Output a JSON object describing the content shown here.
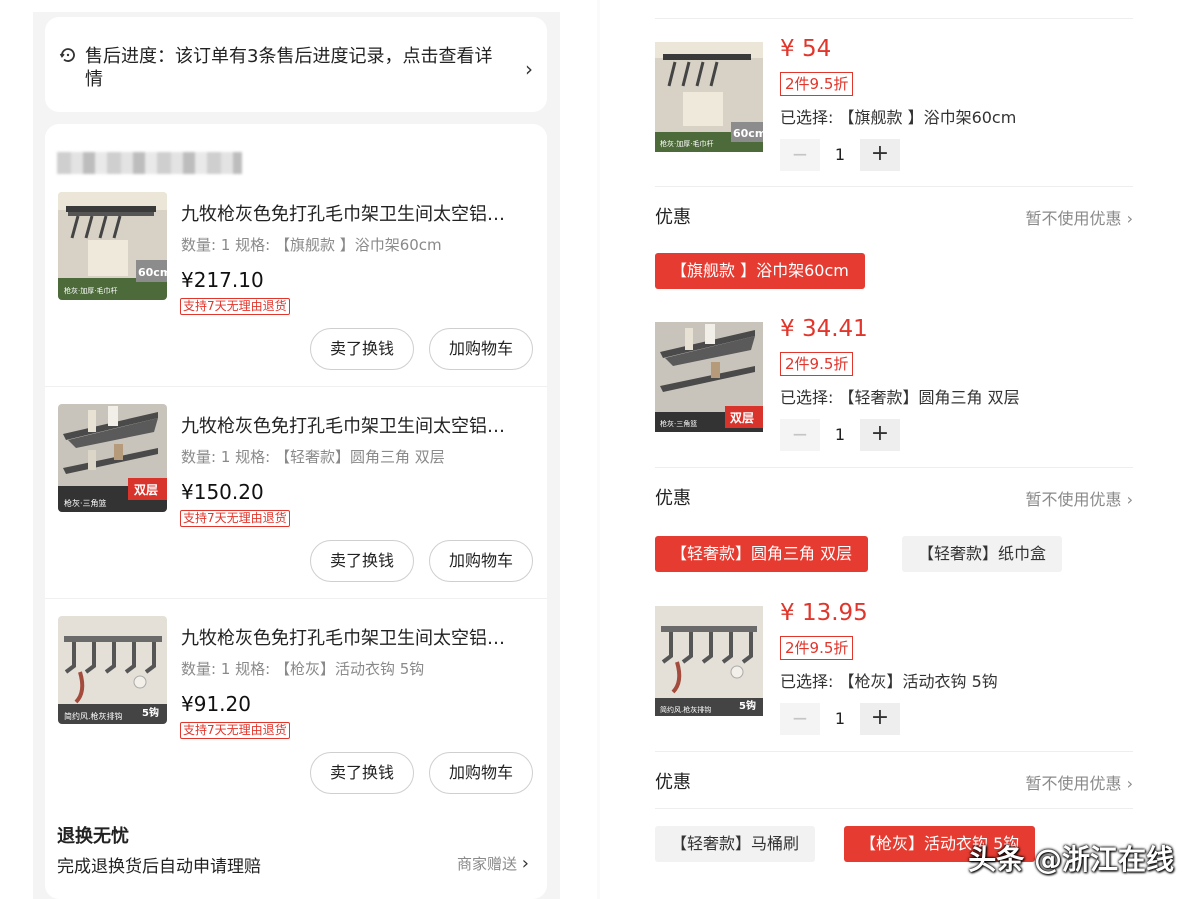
{
  "left": {
    "aftersale": {
      "text": "售后进度：该订单有3条售后进度记录，点击查看详情"
    },
    "items": [
      {
        "title": "九牧枪灰色免打孔毛巾架卫生间太空铝…",
        "spec": "数量: 1  规格: 【旗舰款 】浴巾架60cm",
        "price": "¥217.10",
        "tag": "支持7天无理由退货",
        "sell": "卖了换钱",
        "cart": "加购物车",
        "img_banner": "枪灰·加厚·毛巾杆",
        "img_badge": "60cm"
      },
      {
        "title": "九牧枪灰色免打孔毛巾架卫生间太空铝…",
        "spec": "数量: 1  规格: 【轻奢款】圆角三角 双层",
        "price": "¥150.20",
        "tag": "支持7天无理由退货",
        "sell": "卖了换钱",
        "cart": "加购物车",
        "img_banner": "枪灰·三角篮",
        "img_badge": "双层"
      },
      {
        "title": "九牧枪灰色免打孔毛巾架卫生间太空铝…",
        "spec": "数量: 1  规格: 【枪灰】活动衣钩 5钩",
        "price": "¥91.20",
        "tag": "支持7天无理由退货",
        "sell": "卖了换钱",
        "cart": "加购物车",
        "img_banner": "简约风.枪灰排钩",
        "img_badge": "5钩"
      }
    ],
    "guarantee": {
      "title": "退换无忧",
      "desc": "完成退换货后自动申请理赔",
      "link": "商家赠送"
    }
  },
  "right": {
    "items": [
      {
        "price": "¥ 54",
        "discount": "2件9.5折",
        "selected": "已选择: 【旗舰款 】浴巾架60cm",
        "qty": "1",
        "img_badge": "60cm",
        "img_banner": "枪灰·加厚·毛巾杆"
      },
      {
        "price": "¥ 34.41",
        "discount": "2件9.5折",
        "selected": "已选择: 【轻奢款】圆角三角 双层",
        "qty": "1",
        "img_badge": "双层",
        "img_banner": "枪灰·三角篮"
      },
      {
        "price": "¥ 13.95",
        "discount": "2件9.5折",
        "selected": "已选择: 【枪灰】活动衣钩 5钩",
        "qty": "1",
        "img_badge": "5钩",
        "img_banner": "简约风.枪灰排钩"
      }
    ],
    "promo_label": "优惠",
    "promo_value": "暂不使用优惠",
    "chips": {
      "row1": [
        "【旗舰款 】浴巾架60cm"
      ],
      "row2": [
        "【轻奢款】圆角三角 双层",
        "【轻奢款】纸巾盒"
      ],
      "row3": [
        "【轻奢款】马桶刷",
        "【枪灰】活动衣钩 5钩"
      ]
    },
    "watermark": "头条 @浙江在线"
  },
  "colors": {
    "accent_red": "#e53b31",
    "price_red": "#e0362c",
    "muted": "#8a8a8a",
    "panel_bg": "#f4f4f4"
  },
  "icons": [
    "refresh-clock-icon",
    "chevron-right-icon",
    "minus-icon",
    "plus-icon"
  ]
}
